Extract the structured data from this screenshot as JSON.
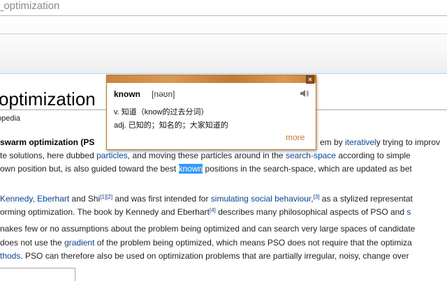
{
  "browser": {
    "url_fragment": "_optimization"
  },
  "article": {
    "title": "optimization",
    "subtitle": "opedia",
    "paragraph1": {
      "l1_a": " swarm optimization",
      "l1_b": " (PS",
      "l1_c": "em by ",
      "l1_link": "iterativel",
      "l1_d": "y trying to improv",
      "l2_a": "te solutions, here dubbed ",
      "l2_link1": "particles",
      "l2_b": ", and moving these particles around in the ",
      "l2_link2": "search-space",
      "l2_c": " according to simple",
      "l3_a": "own position but, is also guided toward the best ",
      "l3_highlight": "known",
      "l3_b": " positions in the search-space, which are updated as bet"
    },
    "paragraph2": {
      "l1_link1": "Kennedy, Eberhart",
      "l1_a": " and Shi",
      "l1_ref1": "[1]",
      "l1_ref2": "[2]",
      "l1_b": " and was first intended for ",
      "l1_link2": "simulating social behaviour",
      "l1_c": ",",
      "l1_ref3": "[3]",
      "l1_d": " as a stylized representat",
      "l2_a": "orming optimization. The book by Kennedy and Eberhart",
      "l2_ref4": "[4]",
      "l2_b": " describes many philosophical aspects of PSO and ",
      "l2_link": "s"
    },
    "paragraph3": {
      "l1": "nakes few or no assumptions about the problem being optimized and can search very large spaces of candidate",
      "l2_a": "does not use the ",
      "l2_link": "gradient",
      "l2_b": " of the problem being optimized, which means PSO does not require that the optimiza",
      "l3_link": "thods",
      "l3_a": ". PSO can therefore also be used on optimization problems that are partially irregular, noisy, change over"
    }
  },
  "popup": {
    "close_label": "×",
    "word": "known",
    "phonetic": "[nəʊn]",
    "def1": "v. 知道（know的过去分词）",
    "def2": "adj. 已知的；知名的；大家知道的",
    "more_label": "more",
    "speaker_icon": "speaker-icon",
    "accent_color": "#d07a30"
  }
}
